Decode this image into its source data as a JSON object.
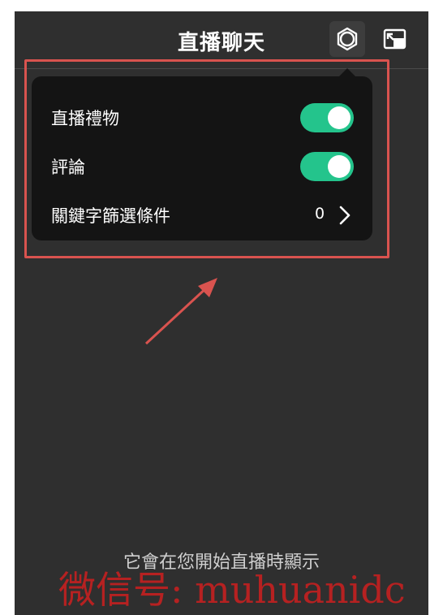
{
  "header": {
    "title": "直播聊天",
    "settings_icon": "gear-icon",
    "popout_icon": "popout-window-icon"
  },
  "settings_popup": {
    "rows": [
      {
        "label": "直播禮物",
        "type": "toggle",
        "enabled": true
      },
      {
        "label": "評論",
        "type": "toggle",
        "enabled": true
      },
      {
        "label": "關鍵字篩選條件",
        "type": "link",
        "count": "0"
      }
    ]
  },
  "chat": {
    "empty_message": "它會在您開始直播時顯示"
  },
  "overlay": {
    "watermark": "微信号: muhuanidc"
  },
  "colors": {
    "panel_bg": "#2f2f2f",
    "popup_bg": "#141414",
    "toggle_on": "#24c48c",
    "annotation": "#d9534f"
  }
}
